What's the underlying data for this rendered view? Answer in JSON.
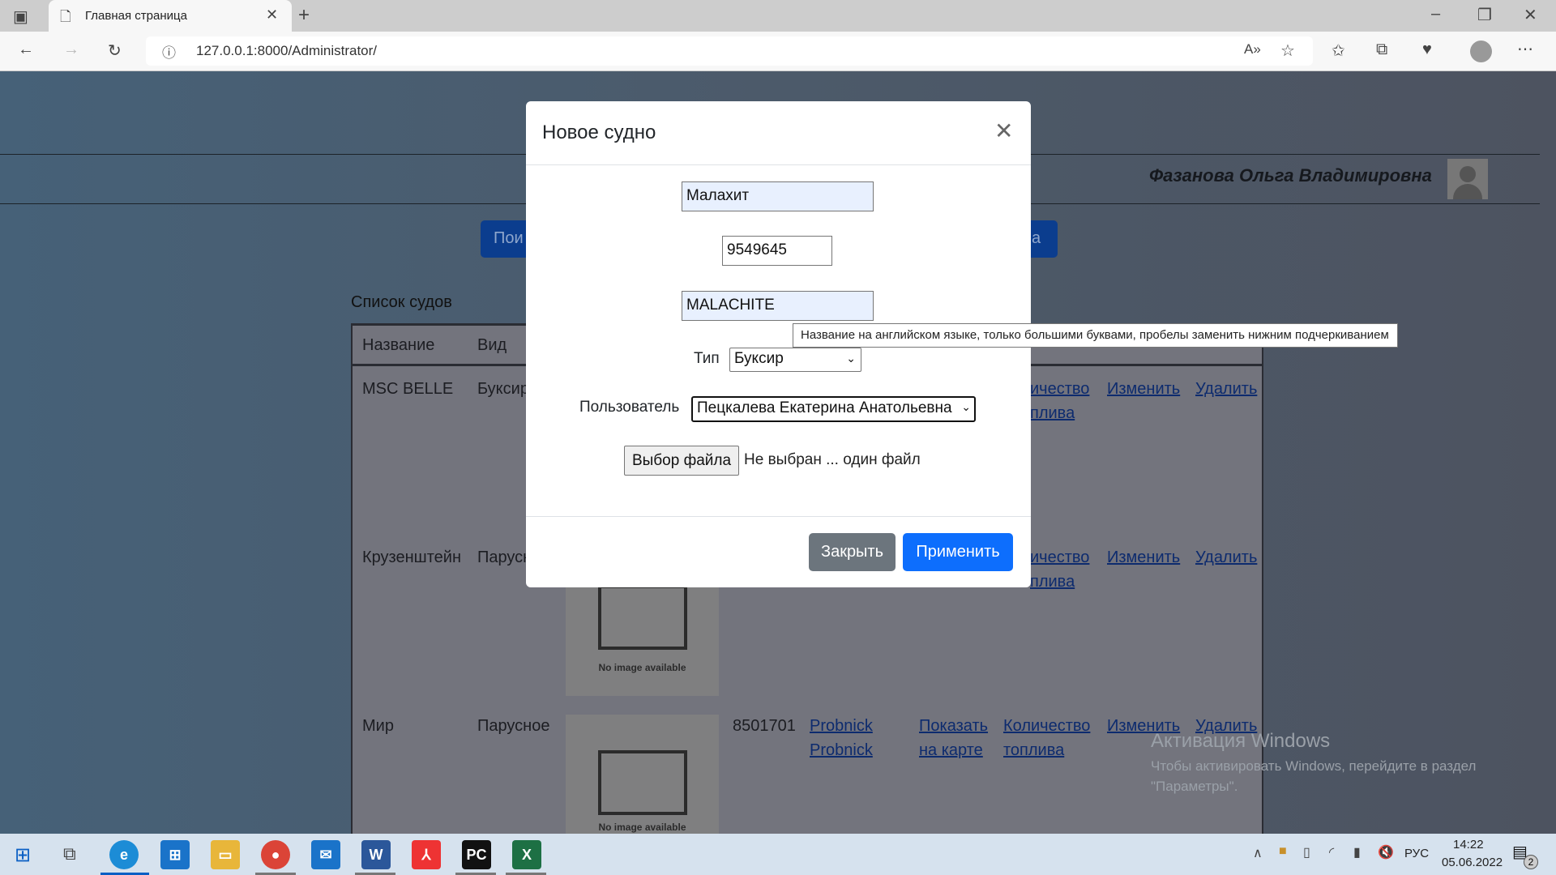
{
  "browser": {
    "tab_title": "Главная страница",
    "url": "127.0.0.1:8000/Administrator/"
  },
  "header": {
    "user_name": "Фазанова Ольга Владимировна",
    "left_button_partial": "Пои",
    "right_button_partial": "на"
  },
  "list": {
    "title": "Список судов",
    "columns": [
      "Название",
      "Вид"
    ],
    "rows": [
      {
        "name": "MSC BELLE",
        "type": "Буксир",
        "imo": "",
        "owner": [
          "",
          ""
        ],
        "map": [
          "",
          ""
        ],
        "fuel": [
          "ичество",
          "плива"
        ],
        "edit": "Изменить",
        "delete": "Удалить",
        "no_image": ""
      },
      {
        "name": "Крузенштейн",
        "type": "Парусн",
        "imo": "",
        "owner": [
          "",
          ""
        ],
        "map": [
          "",
          ""
        ],
        "fuel": [
          "ичество",
          "плива"
        ],
        "edit": "Изменить",
        "delete": "Удалить",
        "no_image": "No image available"
      },
      {
        "name": "Мир",
        "type": "Парусное",
        "imo": "8501701",
        "owner": [
          "Probnick",
          "Probnick"
        ],
        "map": [
          "Показать",
          "на карте"
        ],
        "fuel": [
          "Количество",
          "топлива"
        ],
        "edit": "Изменить",
        "delete": "Удалить",
        "no_image": "No image available"
      }
    ]
  },
  "modal": {
    "title": "Новое судно",
    "name_value": "Малахит",
    "imo_value": "9549645",
    "english_name_value": "MALACHITE",
    "tooltip": "Название на английском языке, только большими буквами, пробелы заменить нижним подчеркиванием",
    "type_label": "Тип",
    "type_value": "Буксир",
    "user_label": "Пользователь",
    "user_value": "Пецкалева Екатерина Анатольевна",
    "file_button": "Выбор файла",
    "file_status": "Не выбран ... один файл",
    "close_button": "Закрыть",
    "apply_button": "Применить"
  },
  "watermark": {
    "title": "Активация Windows",
    "line1": "Чтобы активировать Windows, перейдите в раздел",
    "line2": "\"Параметры\"."
  },
  "taskbar": {
    "lang": "РУС",
    "time": "14:22",
    "date": "05.06.2022",
    "notifications": "2"
  }
}
